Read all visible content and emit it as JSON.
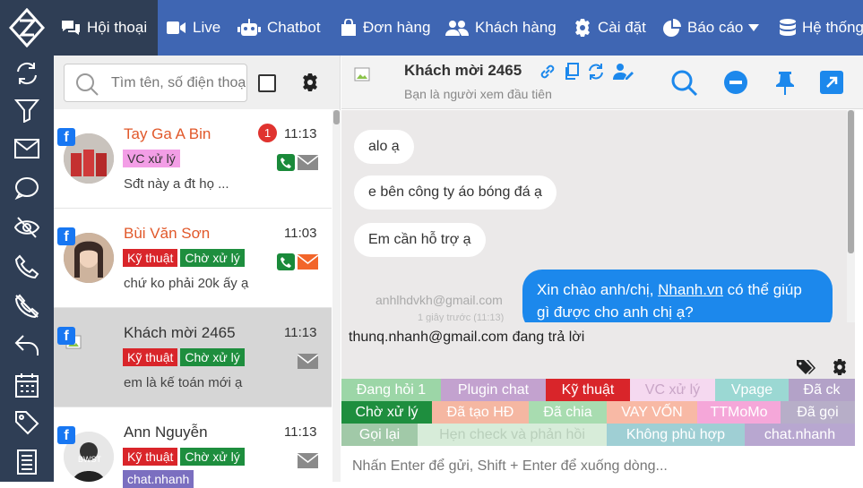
{
  "nav": {
    "items": [
      {
        "label": "Hội thoại",
        "icon": "chat-icon"
      },
      {
        "label": "Live",
        "icon": "video-icon"
      },
      {
        "label": "Chatbot",
        "icon": "robot-icon"
      },
      {
        "label": "Đơn hàng",
        "icon": "bag-icon"
      },
      {
        "label": "Khách hàng",
        "icon": "users-icon"
      },
      {
        "label": "Cài đặt",
        "icon": "gear-icon"
      },
      {
        "label": "Báo cáo",
        "icon": "pie-chart-icon"
      },
      {
        "label": "Hệ thống",
        "icon": "database-icon"
      }
    ]
  },
  "search": {
    "placeholder": "Tìm tên, số điện thoại"
  },
  "conversations": [
    {
      "name": "Tay Ga A Bin",
      "time": "11:13",
      "unread": "1",
      "tags": [
        {
          "label": "VC xử lý",
          "color": "#f39ee6",
          "text": "#333"
        }
      ],
      "preview": "Sđt này a đt họ ..."
    },
    {
      "name": "Bùi Văn Sơn",
      "time": "11:03",
      "tags": [
        {
          "label": "Kỹ thuật",
          "color": "#d9252a",
          "text": "#fff"
        },
        {
          "label": "Chờ xử lý",
          "color": "#1e8e3e",
          "text": "#fff"
        }
      ],
      "preview": "chứ ko phải 20k ấy ạ"
    },
    {
      "name": "Khách mời 2465",
      "time": "11:13",
      "tags": [
        {
          "label": "Kỹ thuật",
          "color": "#d9252a",
          "text": "#fff"
        },
        {
          "label": "Chờ xử lý",
          "color": "#1e8e3e",
          "text": "#fff"
        }
      ],
      "preview": "em là kế toán mới ạ"
    },
    {
      "name": "Ann Nguyễn",
      "time": "11:13",
      "tags": [
        {
          "label": "Kỹ thuật",
          "color": "#d9252a",
          "text": "#fff"
        },
        {
          "label": "Chờ xử lý",
          "color": "#1e8e3e",
          "text": "#fff"
        }
      ],
      "extra_tag": "chat.nhanh",
      "preview": ""
    }
  ],
  "chat": {
    "title": "Khách mời 2465",
    "subtitle": "Bạn là người xem đầu tiên",
    "messages_in": [
      "alo ạ",
      "e bên công ty áo bóng đá ạ",
      "Em cần hỗ trợ ạ"
    ],
    "msg_out_pre": "Xin chào anh/chị, ",
    "msg_out_link": "Nhanh.vn",
    "msg_out_post": " có thể giúp gì được cho anh chị ạ?",
    "sender_email": "anhlhdvkh@gmail.com",
    "sender_time": "1 giây trước (11:13)",
    "typing": "thunq.nhanh@gmail.com đang trả lời",
    "input_placeholder": "Nhấn Enter để gửi, Shift + Enter để xuống dòng..."
  },
  "quick_tags": [
    [
      {
        "label": "Đang hỏi 1",
        "bg": "#9cd6a7",
        "fg": "#fff"
      },
      {
        "label": "Plugin chat",
        "bg": "#c3a2cf",
        "fg": "#fff"
      },
      {
        "label": "Kỹ thuật",
        "bg": "#d9252a",
        "fg": "#fff"
      },
      {
        "label": "VC xử lý",
        "bg": "#f5d9f0",
        "fg": "#c9a6c7"
      },
      {
        "label": "Vpage",
        "bg": "#9bd8d3",
        "fg": "#fff"
      },
      {
        "label": "Đã ck",
        "bg": "#b3a2c8",
        "fg": "#fff"
      }
    ],
    [
      {
        "label": "Chờ xử lý",
        "bg": "#1e8e3e",
        "fg": "#fff"
      },
      {
        "label": "Đã tạo HĐ",
        "bg": "#f5b7a2",
        "fg": "#fff"
      },
      {
        "label": "Đã chia",
        "bg": "#a8dcb0",
        "fg": "#fff"
      },
      {
        "label": "VAY VỐN",
        "bg": "#f8b9a5",
        "fg": "#fff"
      },
      {
        "label": "TTMoMo",
        "bg": "#f5a7d9",
        "fg": "#fff"
      },
      {
        "label": "Đã gọi",
        "bg": "#b7aec8",
        "fg": "#fff"
      }
    ],
    [
      {
        "label": "Gọi lại",
        "bg": "#a1c9a8",
        "fg": "#fff"
      },
      {
        "label": "Hẹn check và phản hồi",
        "bg": "#d7ecd9",
        "fg": "#b9cfbb"
      },
      {
        "label": "Không phù hợp",
        "bg": "#9fcfd4",
        "fg": "#fff"
      },
      {
        "label": "chat.nhanh",
        "bg": "#b8a7d0",
        "fg": "#fff"
      }
    ]
  ]
}
